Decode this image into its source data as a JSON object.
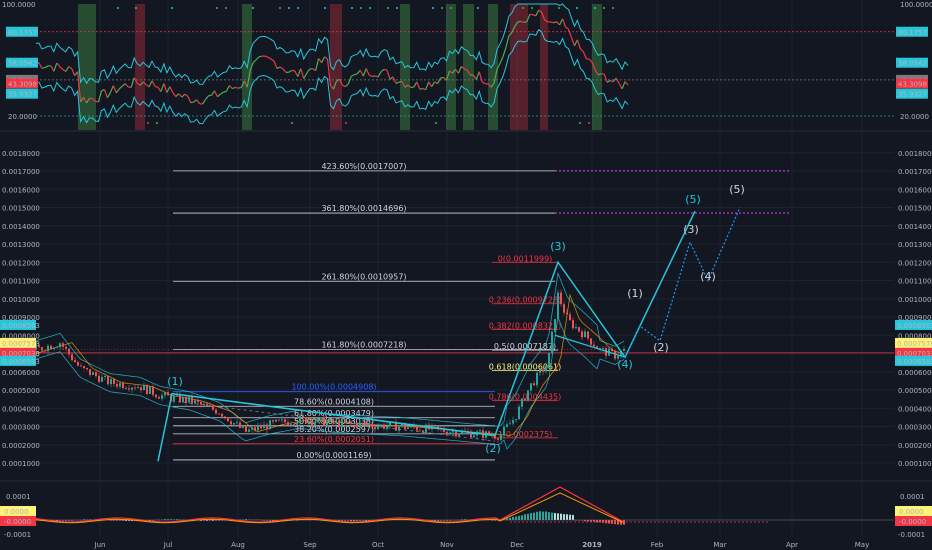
{
  "chart_data": [
    {
      "panel": "oscillator",
      "type": "line",
      "y_ticks": [
        "100.0000",
        "20.0000"
      ],
      "markers": [
        {
          "label": "80.1757",
          "color": "#26c6da",
          "text_color": "#131722"
        },
        {
          "label": "58.0542",
          "color": "#26c6da",
          "text_color": "#131722"
        },
        {
          "label": "45.7938",
          "color": "#787b86",
          "text_color": "#ffffff"
        },
        {
          "label": "43.3098",
          "color": "#f23645",
          "text_color": "#ffffff"
        },
        {
          "label": "35.9327",
          "color": "#26c6da",
          "text_color": "#131722"
        }
      ],
      "ylim": [
        0,
        100
      ]
    },
    {
      "panel": "price",
      "type": "line",
      "y_ticks": [
        "0.0018000",
        "0.0017000",
        "0.0016000",
        "0.0015000",
        "0.0014000",
        "0.0013000",
        "0.0012000",
        "0.0011000",
        "0.0010000",
        "0.0009000",
        "0.0008000",
        "0.0007000",
        "0.0006000",
        "0.0005000",
        "0.0004000",
        "0.0003000",
        "0.0002000",
        "0.0001000"
      ],
      "markers_left": [
        {
          "label": "0.0008563",
          "color": "#26c6da",
          "text_color": "#131722"
        },
        {
          "label": "0.0007578",
          "color": "#fff176",
          "text_color": "#131722"
        },
        {
          "label": "0.0007033",
          "color": "#f23645",
          "text_color": "#ffffff"
        },
        {
          "label": "0.0006593",
          "color": "#26c6da",
          "text_color": "#131722"
        }
      ],
      "markers_right": [
        {
          "label": "0.0008563",
          "color": "#26c6da",
          "text_color": "#131722"
        },
        {
          "label": "0.0007578",
          "color": "#fff176",
          "text_color": "#131722"
        },
        {
          "label": "0.0007033",
          "color": "#f23645",
          "text_color": "#ffffff"
        },
        {
          "label": "0.0006593",
          "color": "#26c6da",
          "text_color": "#131722"
        }
      ],
      "fib_extensions": [
        {
          "label": "423.60%(0.0017007)",
          "value": 0.0017007,
          "color": "#d1d4dc"
        },
        {
          "label": "361.80%(0.0014696)",
          "value": 0.0014696,
          "color": "#d1d4dc"
        },
        {
          "label": "261.80%(0.0010957)",
          "value": 0.0010957,
          "color": "#d1d4dc"
        },
        {
          "label": "161.80%(0.0007218)",
          "value": 0.0007218,
          "color": "#d1d4dc"
        },
        {
          "label": "100.00%(0.0004908)",
          "value": 0.0004908,
          "color": "#2962ff"
        },
        {
          "label": "78.60%(0.0004108)",
          "value": 0.0004108,
          "color": "#d1d4dc"
        },
        {
          "label": "61.80%(0.0003479)",
          "value": 0.0003479,
          "color": "#d1d4dc"
        },
        {
          "label": "50.00%(0.0003038)",
          "value": 0.0003038,
          "color": "#d1d4dc"
        },
        {
          "label": "38.20%(0.0002597)",
          "value": 0.0002597,
          "color": "#d1d4dc"
        },
        {
          "label": "23.60%(0.0002051)",
          "value": 0.0002051,
          "color": "#f23645"
        },
        {
          "label": "0.00%(0.0001169)",
          "value": 0.0001169,
          "color": "#d1d4dc"
        }
      ],
      "fib_retracements": [
        {
          "label": "0(0.0011999)",
          "value": 0.0011999,
          "color": "#f23645"
        },
        {
          "label": "0.236(0.0009728)",
          "value": 0.0009728,
          "color": "#f23645"
        },
        {
          "label": "0.382(0.0008325)",
          "value": 0.0008325,
          "color": "#f23645"
        },
        {
          "label": "0.5(0.0007187)",
          "value": 0.0007187,
          "color": "#d1d4dc"
        },
        {
          "label": "0.618(0.0006061)",
          "value": 0.0006061,
          "color": "#fff176"
        },
        {
          "label": "0.786(0.0004435)",
          "value": 0.0004435,
          "color": "#f23645"
        },
        {
          "label": "1(0.0002375)",
          "value": 0.0002375,
          "color": "#f23645"
        }
      ],
      "wave_labels": [
        {
          "label": "(1)",
          "color": "#26c6da"
        },
        {
          "label": "(2)",
          "color": "#26c6da"
        },
        {
          "label": "(3)",
          "color": "#26c6da"
        },
        {
          "label": "(4)",
          "color": "#26c6da"
        },
        {
          "label": "(5)",
          "color": "#26c6da"
        },
        {
          "label": "(1)",
          "color": "#d1d4dc"
        },
        {
          "label": "(2)",
          "color": "#d1d4dc"
        },
        {
          "label": "(3)",
          "color": "#d1d4dc"
        },
        {
          "label": "(4)",
          "color": "#d1d4dc"
        },
        {
          "label": "(5)",
          "color": "#d1d4dc"
        }
      ],
      "ylim": [
        0.0,
        0.0019
      ]
    },
    {
      "panel": "macd",
      "type": "bar",
      "y_ticks": [
        "0.0001",
        "-0.0001"
      ],
      "markers": [
        {
          "label": "0.0000",
          "color": "#fff176",
          "text_color": "#131722"
        },
        {
          "label": "-0.0000",
          "color": "#f23645",
          "text_color": "#ffffff"
        }
      ]
    }
  ],
  "x_axis": {
    "labels": [
      "Jun",
      "Jul",
      "Aug",
      "Sep",
      "Oct",
      "Nov",
      "Dec",
      "2019",
      "Feb",
      "Mar",
      "Apr",
      "May"
    ]
  },
  "colors": {
    "background": "#131722",
    "grid": "#1e222d",
    "accent_cyan": "#26c6da",
    "red": "#f23645",
    "green": "#4caf50"
  }
}
